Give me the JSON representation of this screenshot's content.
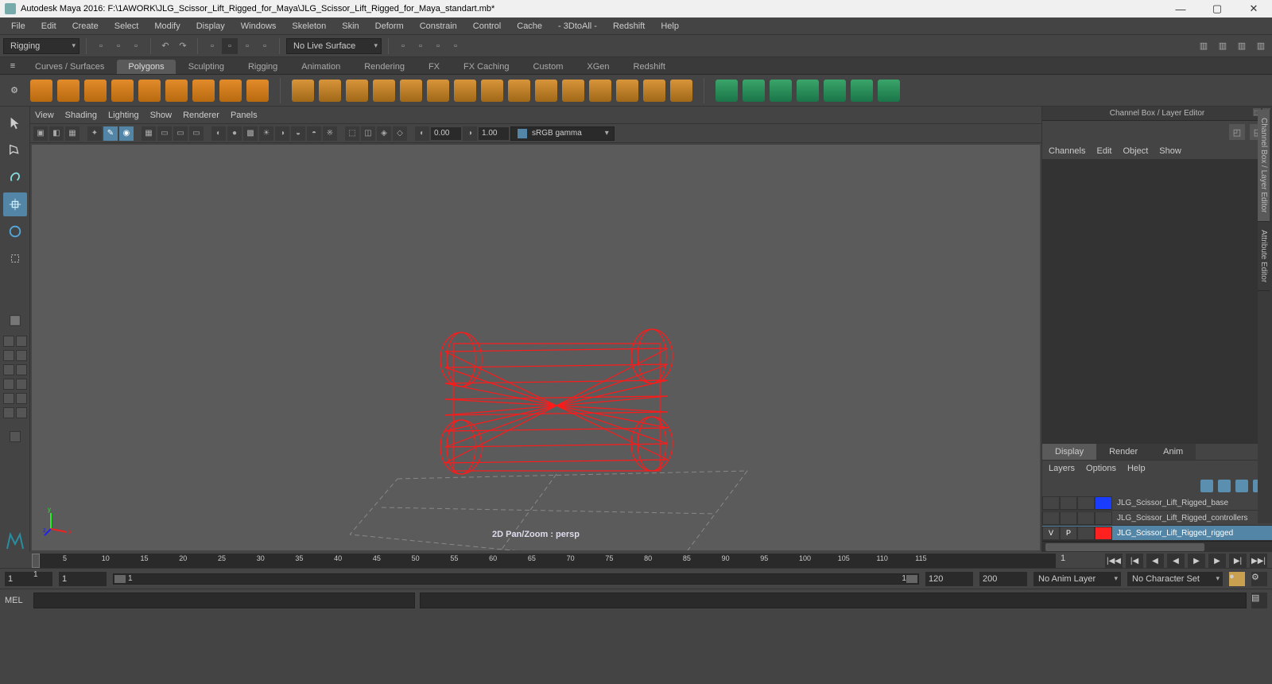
{
  "title": "Autodesk Maya 2016: F:\\1AWORK\\JLG_Scissor_Lift_Rigged_for_Maya\\JLG_Scissor_Lift_Rigged_for_Maya_standart.mb*",
  "menubar": [
    "File",
    "Edit",
    "Create",
    "Select",
    "Modify",
    "Display",
    "Windows",
    "Skeleton",
    "Skin",
    "Deform",
    "Constrain",
    "Control",
    "Cache",
    "- 3DtoAll -",
    "Redshift",
    "Help"
  ],
  "workspace": "Rigging",
  "live_surface": "No Live Surface",
  "shelf_tabs": [
    "Curves / Surfaces",
    "Polygons",
    "Sculpting",
    "Rigging",
    "Animation",
    "Rendering",
    "FX",
    "FX Caching",
    "Custom",
    "XGen",
    "Redshift"
  ],
  "shelf_active": "Polygons",
  "panel_menu": [
    "View",
    "Shading",
    "Lighting",
    "Show",
    "Renderer",
    "Panels"
  ],
  "exposure": "0.00",
  "gamma": "1.00",
  "colorspace": "sRGB gamma",
  "viewport_label": "2D Pan/Zoom : persp",
  "channelbox": {
    "title": "Channel Box / Layer Editor",
    "menu": [
      "Channels",
      "Edit",
      "Object",
      "Show"
    ]
  },
  "sidetabs": [
    "Channel Box / Layer Editor",
    "Attribute Editor"
  ],
  "layer_tabs": [
    "Display",
    "Render",
    "Anim"
  ],
  "layers_menu": [
    "Layers",
    "Options",
    "Help"
  ],
  "layers": [
    {
      "v": "",
      "p": "",
      "color": "#1a3cff",
      "name": "JLG_Scissor_Lift_Rigged_base",
      "sel": false
    },
    {
      "v": "",
      "p": "",
      "color": "#444444",
      "name": "JLG_Scissor_Lift_Rigged_controllers",
      "sel": false
    },
    {
      "v": "V",
      "p": "P",
      "color": "#ff2020",
      "name": "JLG_Scissor_Lift_Rigged_rigged",
      "sel": true
    }
  ],
  "ruler_ticks": [
    1,
    5,
    10,
    15,
    20,
    25,
    30,
    35,
    40,
    45,
    50,
    55,
    60,
    65,
    70,
    75,
    80,
    85,
    90,
    95,
    100,
    105,
    110,
    115
  ],
  "time_current": "1",
  "range_start": "1",
  "range_end": "120",
  "anim_start": "1",
  "anim_end": "120",
  "playback_start": "1",
  "playback_end": "200",
  "anim_layer": "No Anim Layer",
  "char_set": "No Character Set",
  "cmd_lang": "MEL"
}
